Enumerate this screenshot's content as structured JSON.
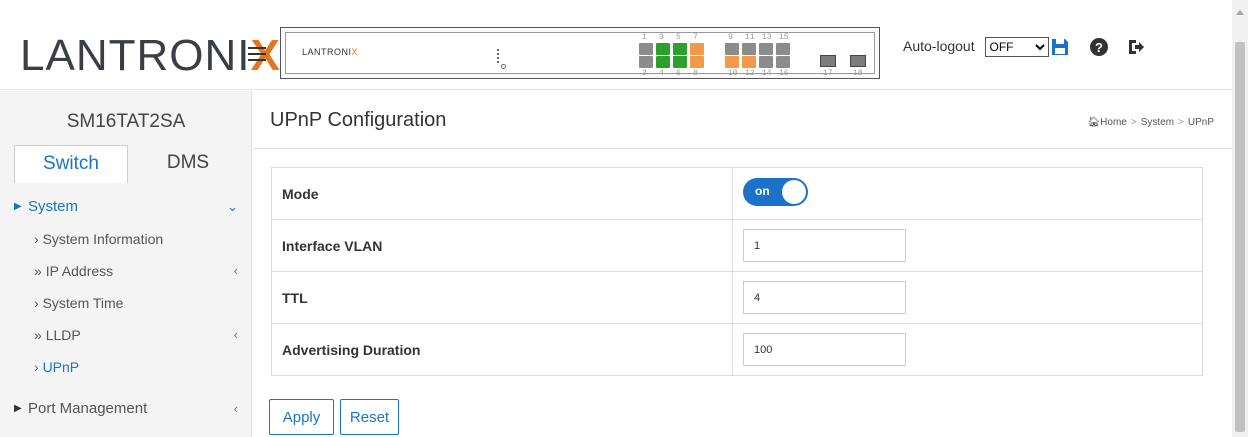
{
  "header": {
    "logo_text": "LANTRONIX",
    "device_brand": "LANTRONIX",
    "port_numbers_top": [
      "1",
      "3",
      "5",
      "7",
      "9",
      "11",
      "13",
      "15"
    ],
    "port_numbers_bottom": [
      "2",
      "4",
      "6",
      "8",
      "10",
      "12",
      "14",
      "16",
      "17",
      "18"
    ],
    "autologout_label": "Auto-logout",
    "autologout_value": "OFF",
    "icons": [
      "menu-icon",
      "save-icon",
      "help-icon",
      "logout-icon"
    ],
    "accent_color": "#1a73c8"
  },
  "sidebar": {
    "device_name": "SM16TAT2SA",
    "tabs": [
      {
        "label": "Switch"
      },
      {
        "label": "DMS"
      }
    ],
    "items": [
      {
        "label": "System"
      },
      {
        "label": "System Information"
      },
      {
        "label": "IP Address"
      },
      {
        "label": "System Time"
      },
      {
        "label": "LLDP"
      },
      {
        "label": "UPnP"
      },
      {
        "label": "Port Management"
      }
    ]
  },
  "main": {
    "title": "UPnP Configuration",
    "breadcrumb": {
      "home": "Home",
      "section": "System",
      "page": "UPnP"
    },
    "rows": [
      {
        "label": "Mode",
        "value": "on"
      },
      {
        "label": "Interface VLAN",
        "value": "1"
      },
      {
        "label": "TTL",
        "value": "4"
      },
      {
        "label": "Advertising Duration",
        "value": "100"
      }
    ],
    "apply_label": "Apply",
    "reset_label": "Reset"
  }
}
